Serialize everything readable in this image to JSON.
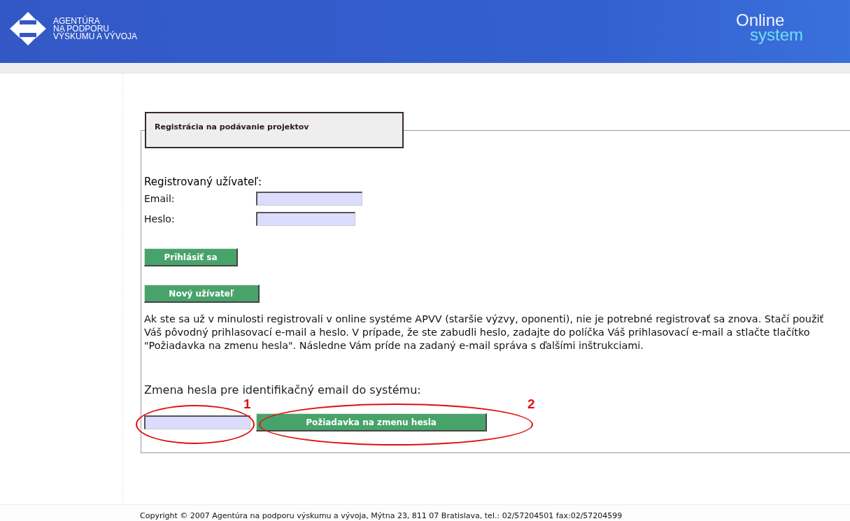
{
  "header": {
    "logo_lines": [
      "AGENTÚRA",
      "NA PODPORU",
      "VÝSKUMU A VÝVOJA"
    ],
    "brand_top": "Online",
    "brand_bottom": "system"
  },
  "panel": {
    "legend": "Registrácia na podávanie projektov",
    "login": {
      "heading": "Registrovaný užívateľ:",
      "fields": [
        {
          "label": "Email:",
          "wide": true
        },
        {
          "label": "Heslo:",
          "wide": false
        }
      ],
      "login_button": "Prihlásiť sa",
      "new_user_button": "Nový užívateľ"
    },
    "info": "Ak ste sa už v minulosti registrovali v online systéme APVV (staršie výzvy, oponenti), nie je potrebné registrovať sa znova. Stačí použiť Váš pôvodný prihlasovací e-mail a heslo. V prípade, že ste zabudli heslo, zadajte do políčka Váš prihlasovací e-mail a stlačte tlačítko \"Požiadavka na zmenu hesla\". Následne Vám príde na zadaný e-mail správa s ďalšími inštrukciami.",
    "reset": {
      "label": "Zmena hesla pre identifikačný email do systému:",
      "button": "Požiadavka na zmenu hesla"
    }
  },
  "annotations": [
    "1",
    "2"
  ],
  "footer": "Copyright © 2007 Agentúra na podporu výskumu a vývoja, Mýtna 23, 811 07 Bratislava, tel.: 02/57204501 fax:02/57204599"
}
